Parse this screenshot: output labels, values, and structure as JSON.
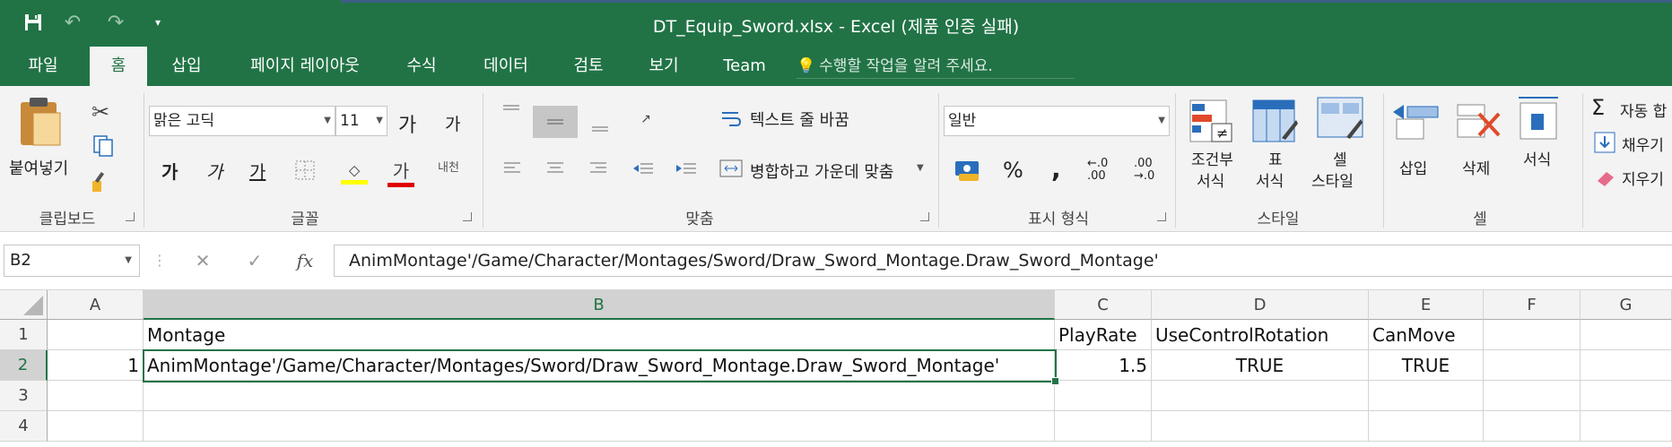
{
  "window": {
    "title": "DT_Equip_Sword.xlsx - Excel (제품 인증 실패)",
    "qat": {
      "save_icon": "save-icon",
      "undo_icon": "undo-icon",
      "redo_icon": "redo-icon",
      "customize_icon": "customize-qat-icon"
    }
  },
  "tabs": [
    "파일",
    "홈",
    "삽입",
    "페이지 레이아웃",
    "수식",
    "데이터",
    "검토",
    "보기",
    "Team"
  ],
  "active_tab": "홈",
  "tell_me": {
    "placeholder": "수행할 작업을 알려 주세요."
  },
  "ribbon": {
    "clipboard": {
      "paste_label": "붙여넣기",
      "group_label": "클립보드"
    },
    "font": {
      "font_name": "맑은 고딕",
      "font_size": "11",
      "grow_label": "가",
      "shrink_label": "가",
      "bold_label": "가",
      "italic_label": "가",
      "underline_label": "가",
      "color_label": "가",
      "phonetic_label": "내천",
      "group_label": "글꼴"
    },
    "alignment": {
      "wrap_text_label": "텍스트 줄 바꿈",
      "merge_label": "병합하고 가운데 맞춤",
      "group_label": "맞춤"
    },
    "number": {
      "format": "일반",
      "percent_label": "%",
      "comma_label": ",",
      "inc_decimal_label": "←.0 .00",
      "dec_decimal_label": ".00 →.0",
      "group_label": "표시 형식"
    },
    "styles": {
      "conditional_label_1": "조건부",
      "conditional_label_2": "서식",
      "table_label_1": "표",
      "table_label_2": "서식",
      "cell_style_label_1": "셀",
      "cell_style_label_2": "스타일",
      "group_label": "스타일"
    },
    "cells": {
      "insert_label": "삽입",
      "delete_label": "삭제",
      "format_label": "서식",
      "group_label": "셀"
    },
    "editing": {
      "autosum_label": "자동 합",
      "fill_label": "채우기",
      "clear_label": "지우기"
    }
  },
  "formula_bar": {
    "name_box": "B2",
    "cancel_label": "✕",
    "enter_label": "✓",
    "fx_label": "fx",
    "content": "AnimMontage'/Game/Character/Montages/Sword/Draw_Sword_Montage.Draw_Sword_Montage'"
  },
  "grid": {
    "columns": [
      "A",
      "B",
      "C",
      "D",
      "E",
      "F",
      "G"
    ],
    "rows": [
      "1",
      "2",
      "3",
      "4"
    ],
    "selected_cell": "B2",
    "cells": {
      "B1": "Montage",
      "C1": "PlayRate",
      "D1": "UseControlRotation",
      "E1": "CanMove",
      "A2": "1",
      "B2": "AnimMontage'/Game/Character/Montages/Sword/Draw_Sword_Montage.Draw_Sword_Montage'",
      "C2": "1.5",
      "D2": "TRUE",
      "E2": "TRUE"
    }
  },
  "colors": {
    "excel_green": "#217346",
    "ribbon_bg": "#f3f3f3"
  }
}
